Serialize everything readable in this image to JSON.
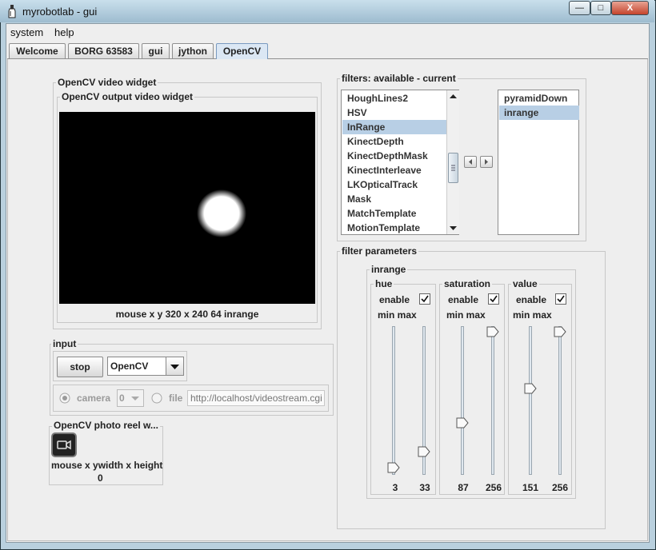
{
  "window": {
    "title": "myrobotlab - gui",
    "btn_min": "—",
    "btn_max": "□",
    "btn_close": "X"
  },
  "menu": [
    "system",
    "help"
  ],
  "tabs": [
    "Welcome",
    "BORG 63583",
    "gui",
    "jython",
    "OpenCV"
  ],
  "video_widget": {
    "title": "OpenCV  video widget",
    "output_title": "OpenCV output video widget",
    "status": "mouse x y  320 x 240  64  inrange"
  },
  "input": {
    "title": "input",
    "stop_label": "stop",
    "source_value": "OpenCV",
    "camera_label": "camera",
    "camera_index": "0",
    "file_label": "file",
    "file_placeholder": "http://localhost/videostream.cgi"
  },
  "photo_reel": {
    "title": "OpenCV  photo reel w...",
    "mouse_label": "mouse x ywidth x height",
    "count": "0"
  },
  "filters": {
    "title": "filters: available - current",
    "available": [
      "HoughLines2",
      "HSV",
      "InRange",
      "KinectDepth",
      "KinectDepthMask",
      "KinectInterleave",
      "LKOpticalTrack",
      "Mask",
      "MatchTemplate",
      "MotionTemplate"
    ],
    "available_selected": "InRange",
    "current": [
      "pyramidDown",
      "inrange"
    ],
    "current_selected": "inrange"
  },
  "filter_parameters": {
    "title": "filter parameters",
    "inrange_title": "inrange",
    "channels": [
      {
        "name": "hue",
        "enable_label": "enable",
        "enabled": true,
        "minmax_label": "min max",
        "min": "3",
        "max": "33",
        "min_frac": 0.012,
        "max_frac": 0.13
      },
      {
        "name": "saturation",
        "enable_label": "enable",
        "enabled": true,
        "minmax_label": "min max",
        "min": "87",
        "max": "256",
        "min_frac": 0.34,
        "max_frac": 1.0
      },
      {
        "name": "value",
        "enable_label": "enable",
        "enabled": true,
        "minmax_label": "min max",
        "min": "151",
        "max": "256",
        "min_frac": 0.59,
        "max_frac": 1.0
      }
    ]
  },
  "colors": {
    "selection": "#b8cfe5",
    "active_tab": "#dbe7f4",
    "video_bg": "#000000"
  }
}
